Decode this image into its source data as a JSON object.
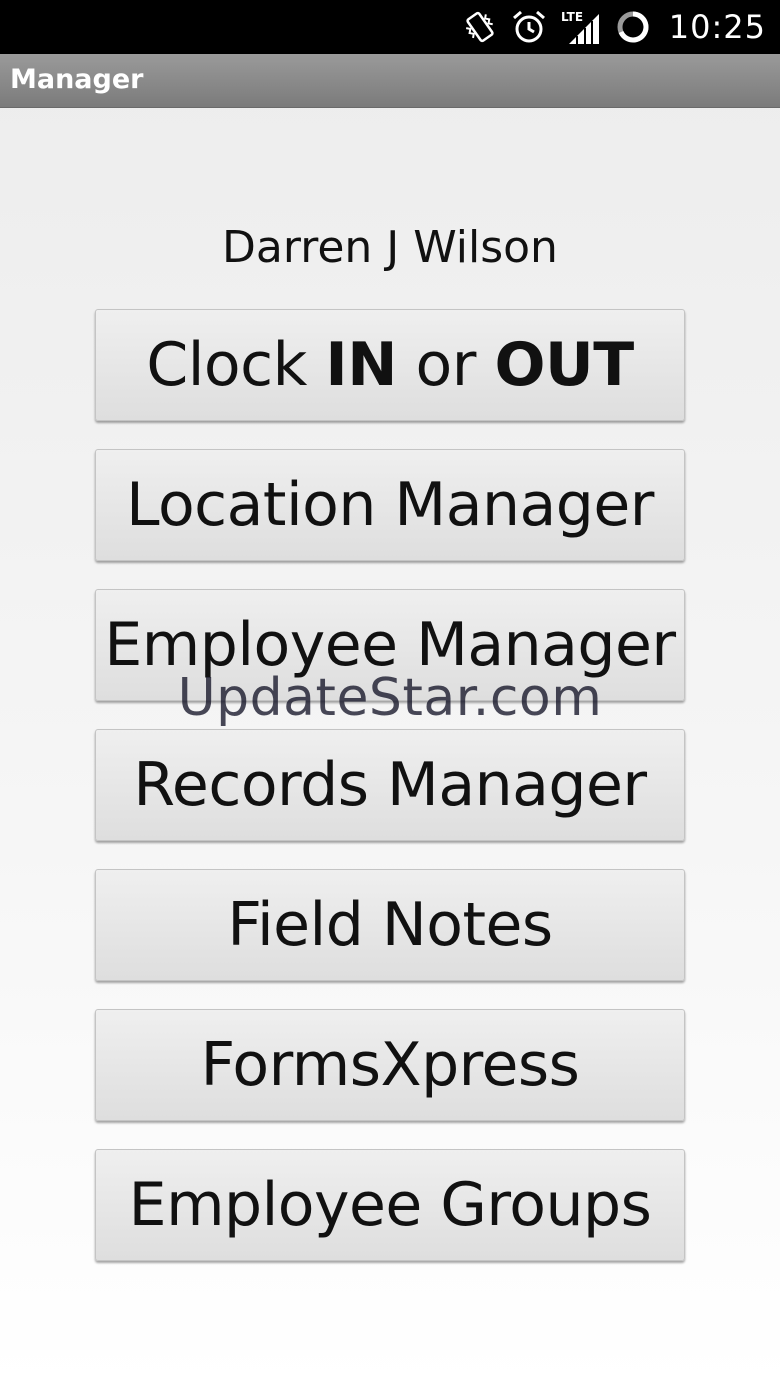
{
  "status_bar": {
    "network_label": "LTE",
    "time": "10:25",
    "icons": [
      "vibrate-icon",
      "alarm-icon",
      "lte-signal-icon",
      "sync-icon"
    ]
  },
  "action_bar": {
    "title": "Manager"
  },
  "user": {
    "name": "Darren J Wilson"
  },
  "menu": {
    "clock": {
      "part1": "Clock ",
      "part2": "IN",
      "part3": " or ",
      "part4": "OUT"
    },
    "items": [
      {
        "label": "Location Manager"
      },
      {
        "label": "Employee Manager"
      },
      {
        "label": "Records Manager"
      },
      {
        "label": "Field Notes"
      },
      {
        "label": "FormsXpress"
      },
      {
        "label": "Employee Groups"
      }
    ]
  },
  "watermark": {
    "text": "UpdateStar.com"
  }
}
